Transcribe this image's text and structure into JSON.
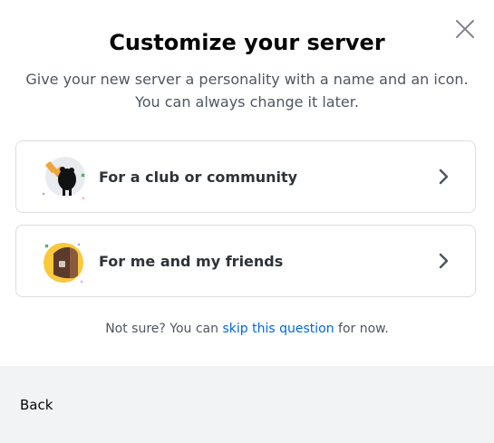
{
  "modal": {
    "title": "Customize your server",
    "subtitle": "Give your new server a personality with a name and an icon. You can always change it later."
  },
  "options": [
    {
      "label": "For a club or community",
      "icon": "club-community-icon"
    },
    {
      "label": "For me and my friends",
      "icon": "friends-icon"
    }
  ],
  "hint": {
    "prefix": "Not sure? You can ",
    "link": "skip this question",
    "suffix": " for now."
  },
  "footer": {
    "back_label": "Back"
  },
  "colors": {
    "link": "#0068e0",
    "title": "#060607",
    "text_muted": "#4f5660",
    "footer_bg": "#f2f3f5",
    "border": "#dcdee2"
  }
}
